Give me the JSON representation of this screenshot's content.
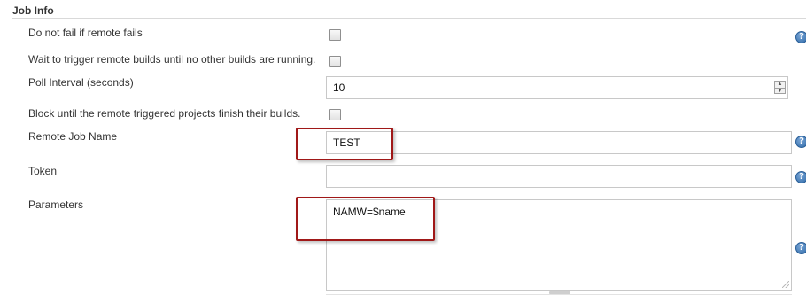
{
  "section": {
    "title": "Job Info"
  },
  "fields": {
    "do_not_fail": {
      "label": "Do not fail if remote fails",
      "checked": false
    },
    "wait_to_trigger": {
      "label": "Wait to trigger remote builds until no other builds are running.",
      "checked": false
    },
    "poll_interval": {
      "label": "Poll Interval (seconds)",
      "value": "10"
    },
    "block_until": {
      "label": "Block until the remote triggered projects finish their builds.",
      "checked": false
    },
    "remote_job_name": {
      "label": "Remote Job Name",
      "value": "TEST"
    },
    "token": {
      "label": "Token",
      "value": ""
    },
    "parameters": {
      "label": "Parameters",
      "value": "NAMW=$name"
    }
  },
  "icons": {
    "help": "help-icon",
    "help_glyph": "?"
  },
  "colors": {
    "highlight": "#a01818",
    "help_icon": "#2f6aa8"
  }
}
